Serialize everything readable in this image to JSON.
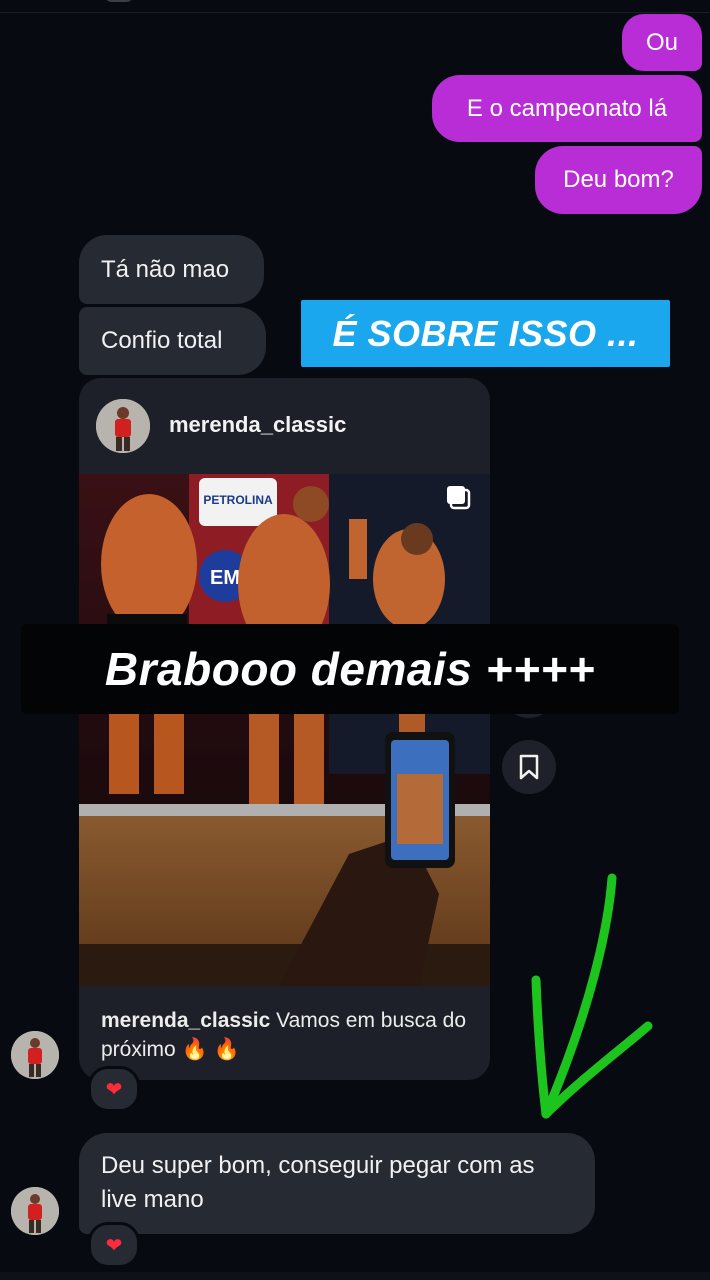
{
  "messages_out": {
    "ou": "Ou",
    "campeonato": "E o campeonato lá",
    "deu_bom": "Deu bom?"
  },
  "messages_in": {
    "ta_nao": "Tá não mao",
    "confio": "Confio total",
    "deu_super": "Deu super bom, conseguir pegar com as live mano"
  },
  "stickers": {
    "blue": "É SOBRE ISSO ...",
    "black": "Brabooo demais ++++"
  },
  "shared_post": {
    "username": "merenda_classic",
    "caption_user": "merenda_classic",
    "caption_text": "Vamos em busca do próximo 🔥 🔥",
    "banner_text": "PETROLINA",
    "banner_sub": "EM"
  },
  "reactions": {
    "post": "❤",
    "last": "❤"
  },
  "icons": {
    "save": "bookmark-icon",
    "multi": "multi-media-icon",
    "arrow": "green-arrow-icon"
  },
  "colors": {
    "outgoing": "#b92dd6",
    "incoming": "#262a33",
    "sticker_blue": "#1ba7ee",
    "arrow_green": "#1ec41e",
    "heart": "#ff2a3a"
  }
}
